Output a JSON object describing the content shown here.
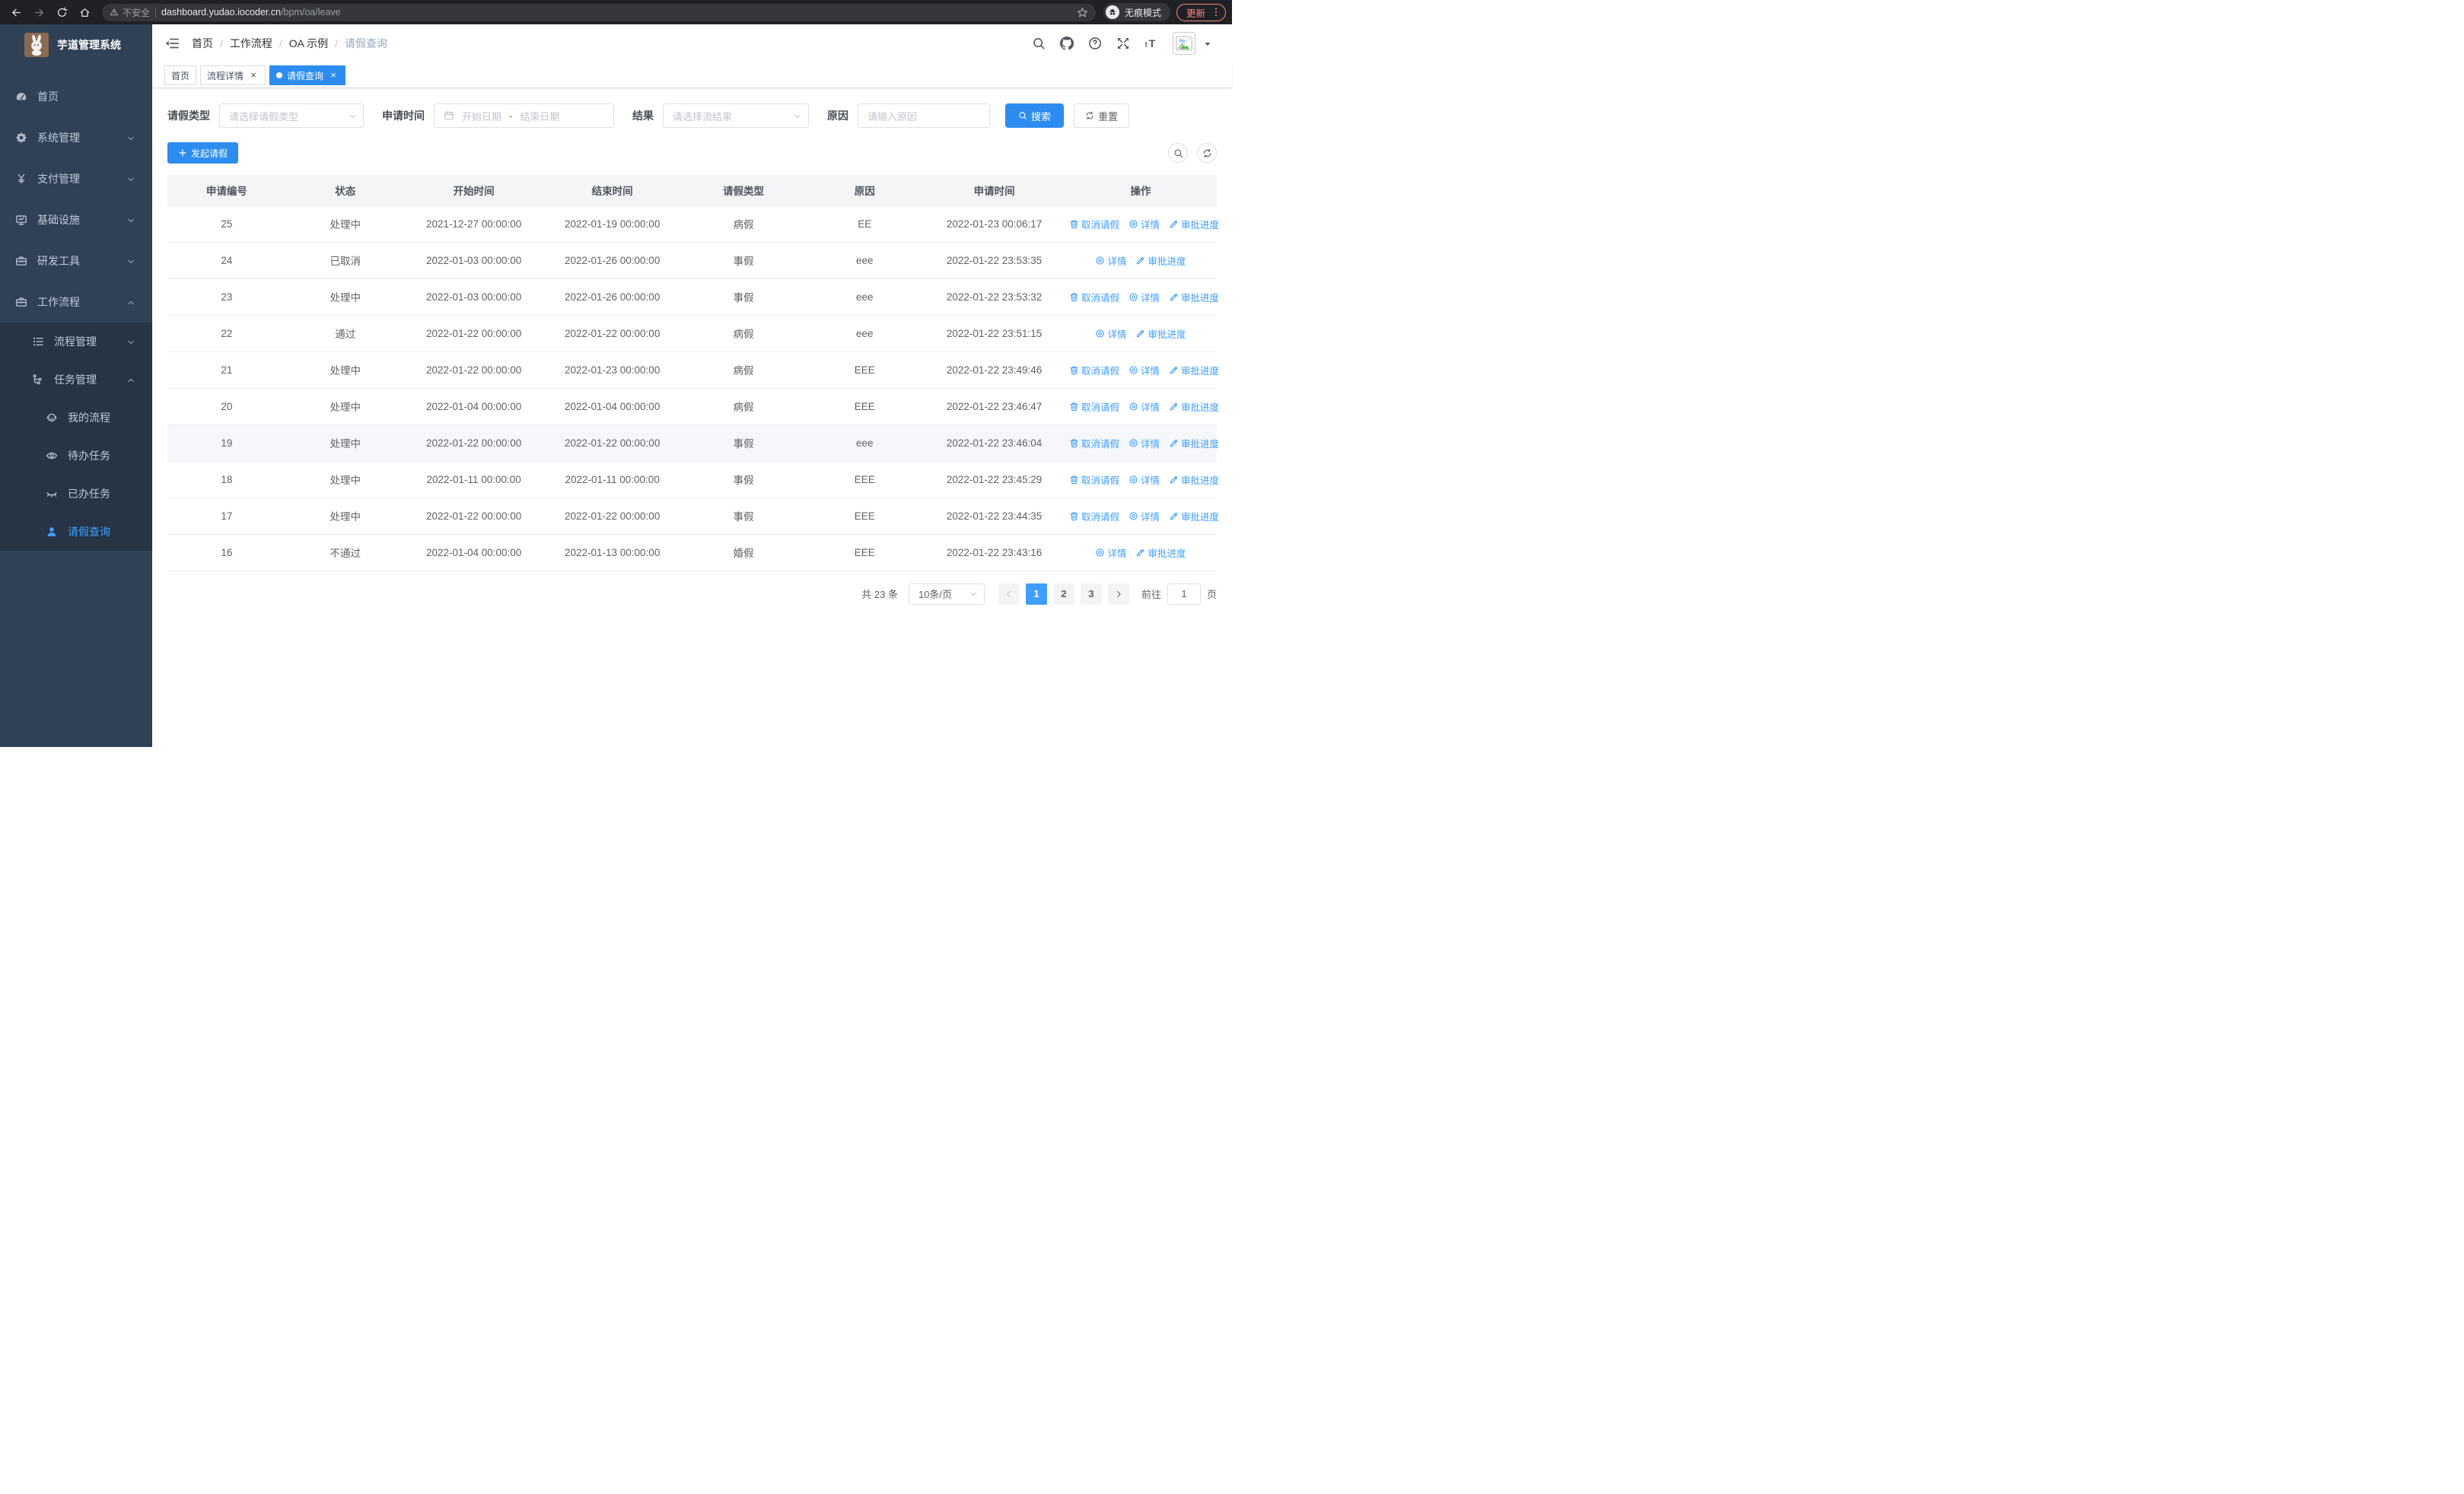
{
  "browser": {
    "security_label": "不安全",
    "url_host": "dashboard.yudao.iocoder.cn",
    "url_path": "/bpm/oa/leave",
    "incognito_label": "无痕模式",
    "update_label": "更新"
  },
  "sidebar": {
    "title": "芋道管理系统",
    "items": [
      {
        "key": "home",
        "label": "首页",
        "icon": "dashboard",
        "level": 1
      },
      {
        "key": "system",
        "label": "系统管理",
        "icon": "gear",
        "level": 1,
        "arrow": "down"
      },
      {
        "key": "payment",
        "label": "支付管理",
        "icon": "yen",
        "level": 1,
        "arrow": "down"
      },
      {
        "key": "infra",
        "label": "基础设施",
        "icon": "monitor",
        "level": 1,
        "arrow": "down"
      },
      {
        "key": "devtools",
        "label": "研发工具",
        "icon": "briefcase",
        "level": 1,
        "arrow": "down"
      },
      {
        "key": "workflow",
        "label": "工作流程",
        "icon": "briefcase",
        "level": 1,
        "arrow": "up"
      },
      {
        "key": "process-mgmt",
        "label": "流程管理",
        "icon": "list-tree",
        "level": 2,
        "arrow": "down",
        "nested": true
      },
      {
        "key": "task-mgmt",
        "label": "任务管理",
        "icon": "org-tree",
        "level": 2,
        "arrow": "up",
        "nested": true
      },
      {
        "key": "my-process",
        "label": "我的流程",
        "icon": "robot",
        "level": 3,
        "nested": true
      },
      {
        "key": "todo-tasks",
        "label": "待办任务",
        "icon": "eye-open",
        "level": 3,
        "nested": true
      },
      {
        "key": "done-tasks",
        "label": "已办任务",
        "icon": "eye-closed",
        "level": 3,
        "nested": true
      },
      {
        "key": "leave-query",
        "label": "请假查询",
        "icon": "user",
        "level": 3,
        "nested": true,
        "active": true
      }
    ]
  },
  "navbar": {
    "breadcrumb": [
      "首页",
      "工作流程",
      "OA 示例",
      "请假查询"
    ]
  },
  "tabs": [
    {
      "key": "home",
      "label": "首页",
      "closable": false,
      "active": false
    },
    {
      "key": "process-detail",
      "label": "流程详情",
      "closable": true,
      "active": false
    },
    {
      "key": "leave-query",
      "label": "请假查询",
      "closable": true,
      "active": true
    }
  ],
  "filters": {
    "leave_type_label": "请假类型",
    "leave_type_placeholder": "请选择请假类型",
    "apply_time_label": "申请时间",
    "date_start_placeholder": "开始日期",
    "date_separator": "-",
    "date_end_placeholder": "结束日期",
    "result_label": "结果",
    "result_placeholder": "请选择流结果",
    "reason_label": "原因",
    "reason_placeholder": "请输入原因",
    "search_label": "搜索",
    "reset_label": "重置"
  },
  "toolbar": {
    "create_label": "发起请假"
  },
  "table": {
    "columns": [
      {
        "label": "申请编号",
        "width": "11.3%"
      },
      {
        "label": "状态",
        "width": "11.3%"
      },
      {
        "label": "开始时间",
        "width": "13.2%"
      },
      {
        "label": "结束时间",
        "width": "13.2%"
      },
      {
        "label": "请假类型",
        "width": "11.8%"
      },
      {
        "label": "原因",
        "width": "11.3%"
      },
      {
        "label": "申请时间",
        "width": "13.4%"
      },
      {
        "label": "操作",
        "width": "14.5%"
      }
    ],
    "action_labels": {
      "cancel": "取消请假",
      "detail": "详情",
      "progress": "审批进度"
    },
    "rows": [
      {
        "id": "25",
        "status": "处理中",
        "start": "2021-12-27 00:00:00",
        "end": "2022-01-19 00:00:00",
        "type": "病假",
        "reason": "EE",
        "apply_time": "2022-01-23 00:06:17",
        "actions": [
          "cancel",
          "detail",
          "progress"
        ]
      },
      {
        "id": "24",
        "status": "已取消",
        "start": "2022-01-03 00:00:00",
        "end": "2022-01-26 00:00:00",
        "type": "事假",
        "reason": "eee",
        "apply_time": "2022-01-22 23:53:35",
        "actions": [
          "detail",
          "progress"
        ]
      },
      {
        "id": "23",
        "status": "处理中",
        "start": "2022-01-03 00:00:00",
        "end": "2022-01-26 00:00:00",
        "type": "事假",
        "reason": "eee",
        "apply_time": "2022-01-22 23:53:32",
        "actions": [
          "cancel",
          "detail",
          "progress"
        ]
      },
      {
        "id": "22",
        "status": "通过",
        "start": "2022-01-22 00:00:00",
        "end": "2022-01-22 00:00:00",
        "type": "病假",
        "reason": "eee",
        "apply_time": "2022-01-22 23:51:15",
        "actions": [
          "detail",
          "progress"
        ]
      },
      {
        "id": "21",
        "status": "处理中",
        "start": "2022-01-22 00:00:00",
        "end": "2022-01-23 00:00:00",
        "type": "病假",
        "reason": "EEE",
        "apply_time": "2022-01-22 23:49:46",
        "actions": [
          "cancel",
          "detail",
          "progress"
        ]
      },
      {
        "id": "20",
        "status": "处理中",
        "start": "2022-01-04 00:00:00",
        "end": "2022-01-04 00:00:00",
        "type": "病假",
        "reason": "EEE",
        "apply_time": "2022-01-22 23:46:47",
        "actions": [
          "cancel",
          "detail",
          "progress"
        ]
      },
      {
        "id": "19",
        "status": "处理中",
        "start": "2022-01-22 00:00:00",
        "end": "2022-01-22 00:00:00",
        "type": "事假",
        "reason": "eee",
        "apply_time": "2022-01-22 23:46:04",
        "actions": [
          "cancel",
          "detail",
          "progress"
        ],
        "highlighted": true
      },
      {
        "id": "18",
        "status": "处理中",
        "start": "2022-01-11 00:00:00",
        "end": "2022-01-11 00:00:00",
        "type": "事假",
        "reason": "EEE",
        "apply_time": "2022-01-22 23:45:29",
        "actions": [
          "cancel",
          "detail",
          "progress"
        ]
      },
      {
        "id": "17",
        "status": "处理中",
        "start": "2022-01-22 00:00:00",
        "end": "2022-01-22 00:00:00",
        "type": "事假",
        "reason": "EEE",
        "apply_time": "2022-01-22 23:44:35",
        "actions": [
          "cancel",
          "detail",
          "progress"
        ]
      },
      {
        "id": "16",
        "status": "不通过",
        "start": "2022-01-04 00:00:00",
        "end": "2022-01-13 00:00:00",
        "type": "婚假",
        "reason": "EEE",
        "apply_time": "2022-01-22 23:43:16",
        "actions": [
          "detail",
          "progress"
        ]
      }
    ]
  },
  "pagination": {
    "total_label": "共 23 条",
    "page_size_label": "10条/页",
    "pages": [
      "1",
      "2",
      "3"
    ],
    "active_page": "1",
    "goto_label": "前往",
    "goto_value": "1",
    "goto_suffix": "页"
  },
  "colors": {
    "primary_button": "#2d8cf0",
    "link": "#409EFF",
    "sidebar_bg": "#304156",
    "sidebar_nested_bg": "#263445",
    "update_badge": "#f28b82"
  }
}
